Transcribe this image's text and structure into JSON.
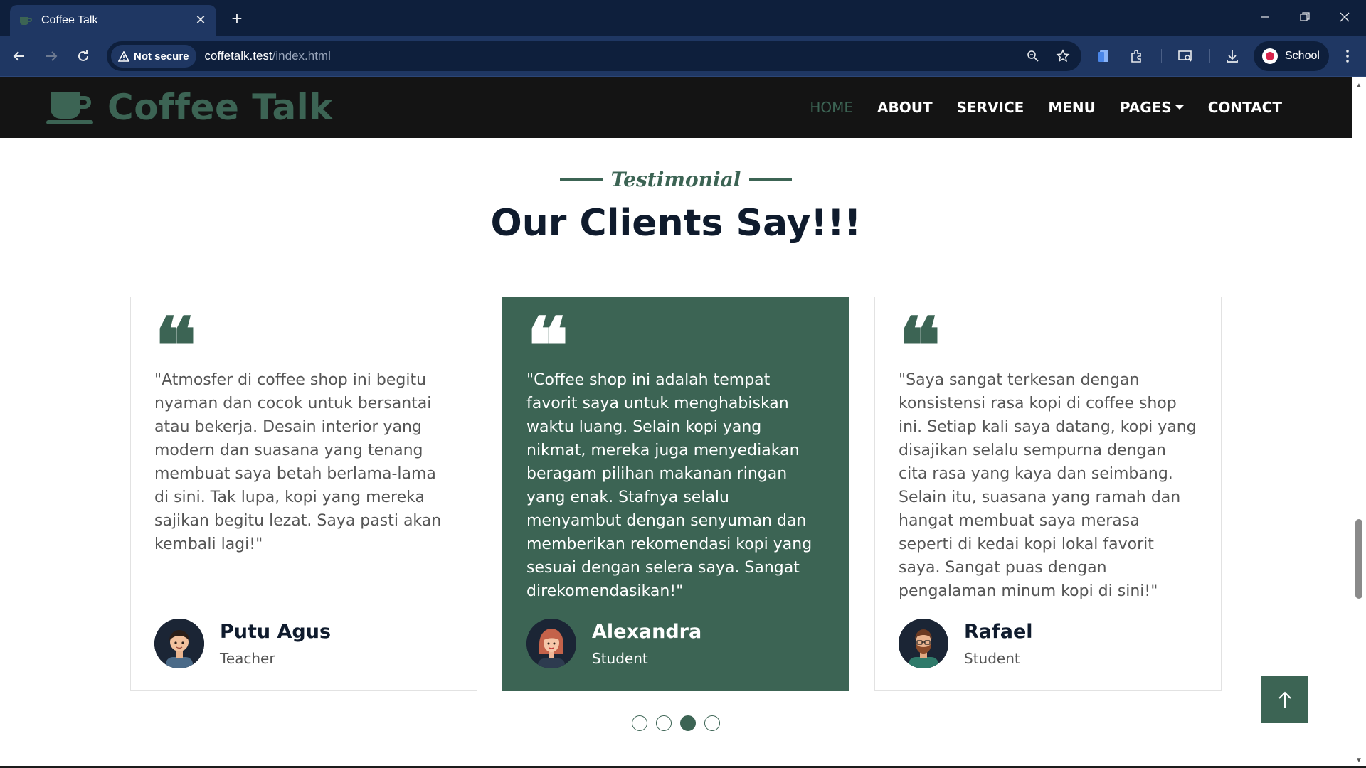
{
  "browser": {
    "tab_title": "Coffee Talk",
    "security_label": "Not secure",
    "url_host": "coffetalk.test",
    "url_path": "/index.html",
    "profile_label": "School"
  },
  "site": {
    "logo_text": "Coffee Talk",
    "nav": [
      {
        "label": "HOME",
        "active": true
      },
      {
        "label": "ABOUT"
      },
      {
        "label": "SERVICE"
      },
      {
        "label": "MENU"
      },
      {
        "label": "PAGES",
        "dropdown": true
      },
      {
        "label": "CONTACT"
      }
    ]
  },
  "section": {
    "subtitle": "Testimonial",
    "title": "Our Clients Say!!!"
  },
  "testimonials": [
    {
      "quote": "\"Atmosfer di coffee shop ini begitu nyaman dan cocok untuk bersantai atau bekerja. Desain interior yang modern dan suasana yang tenang membuat saya betah berlama-lama di sini. Tak lupa, kopi yang mereka sajikan begitu lezat. Saya pasti akan kembali lagi!\"",
      "name": "Putu Agus",
      "role": "Teacher"
    },
    {
      "quote": "\"Coffee shop ini adalah tempat favorit saya untuk menghabiskan waktu luang. Selain kopi yang nikmat, mereka juga menyediakan beragam pilihan makanan ringan yang enak. Stafnya selalu menyambut dengan senyuman dan memberikan rekomendasi kopi yang sesuai dengan selera saya. Sangat direkomendasikan!\"",
      "name": "Alexandra",
      "role": "Student"
    },
    {
      "quote": "\"Saya sangat terkesan dengan konsistensi rasa kopi di coffee shop ini. Setiap kali saya datang, kopi yang disajikan selalu sempurna dengan cita rasa yang kaya dan seimbang. Selain itu, suasana yang ramah dan hangat membuat saya merasa seperti di kedai kopi lokal favorit saya. Sangat puas dengan pengalaman minum kopi di sini!\"",
      "name": "Rafael",
      "role": "Student"
    }
  ],
  "carousel": {
    "pages": 4,
    "active_page": 3
  },
  "colors": {
    "brand": "#3c6454",
    "nav_bg": "#141414",
    "heading": "#0f1b2d",
    "chrome_dark": "#0e1f3c",
    "chrome": "#1f3763"
  }
}
